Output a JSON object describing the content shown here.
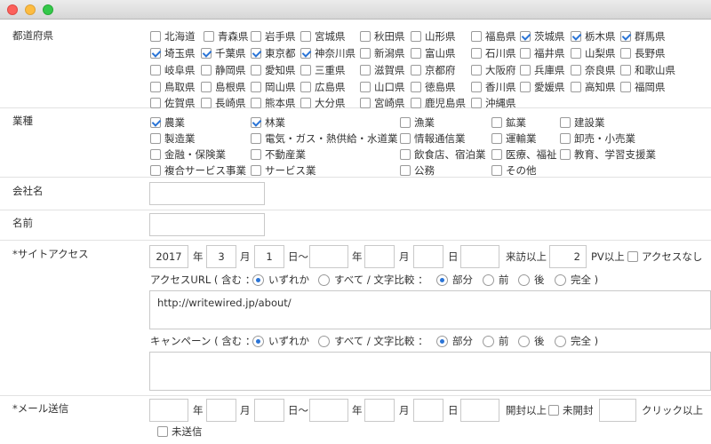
{
  "labels": {
    "prefecture": "都道府県",
    "industry": "業種",
    "company": "会社名",
    "name": "名前",
    "site_access": "*サイトアクセス",
    "mail": "*メール送信"
  },
  "prefectures": [
    {
      "label": "北海道",
      "checked": false
    },
    {
      "label": "青森県",
      "checked": false
    },
    {
      "label": "岩手県",
      "checked": false
    },
    {
      "label": "宮城県",
      "checked": false
    },
    {
      "label": "秋田県",
      "checked": false
    },
    {
      "label": "山形県",
      "checked": false
    },
    {
      "label": "福島県",
      "checked": false
    },
    {
      "label": "茨城県",
      "checked": true
    },
    {
      "label": "栃木県",
      "checked": true
    },
    {
      "label": "群馬県",
      "checked": true
    },
    {
      "label": "埼玉県",
      "checked": true
    },
    {
      "label": "千葉県",
      "checked": true
    },
    {
      "label": "東京都",
      "checked": true
    },
    {
      "label": "神奈川県",
      "checked": true
    },
    {
      "label": "新潟県",
      "checked": false
    },
    {
      "label": "富山県",
      "checked": false
    },
    {
      "label": "石川県",
      "checked": false
    },
    {
      "label": "福井県",
      "checked": false
    },
    {
      "label": "山梨県",
      "checked": false
    },
    {
      "label": "長野県",
      "checked": false
    },
    {
      "label": "岐阜県",
      "checked": false
    },
    {
      "label": "静岡県",
      "checked": false
    },
    {
      "label": "愛知県",
      "checked": false
    },
    {
      "label": "三重県",
      "checked": false
    },
    {
      "label": "滋賀県",
      "checked": false
    },
    {
      "label": "京都府",
      "checked": false
    },
    {
      "label": "大阪府",
      "checked": false
    },
    {
      "label": "兵庫県",
      "checked": false
    },
    {
      "label": "奈良県",
      "checked": false
    },
    {
      "label": "和歌山県",
      "checked": false
    },
    {
      "label": "鳥取県",
      "checked": false
    },
    {
      "label": "島根県",
      "checked": false
    },
    {
      "label": "岡山県",
      "checked": false
    },
    {
      "label": "広島県",
      "checked": false
    },
    {
      "label": "山口県",
      "checked": false
    },
    {
      "label": "徳島県",
      "checked": false
    },
    {
      "label": "香川県",
      "checked": false
    },
    {
      "label": "愛媛県",
      "checked": false
    },
    {
      "label": "高知県",
      "checked": false
    },
    {
      "label": "福岡県",
      "checked": false
    },
    {
      "label": "佐賀県",
      "checked": false
    },
    {
      "label": "長崎県",
      "checked": false
    },
    {
      "label": "熊本県",
      "checked": false
    },
    {
      "label": "大分県",
      "checked": false
    },
    {
      "label": "宮崎県",
      "checked": false
    },
    {
      "label": "鹿児島県",
      "checked": false
    },
    {
      "label": "沖縄県",
      "checked": false
    }
  ],
  "industries": [
    {
      "label": "農業",
      "checked": true
    },
    {
      "label": "林業",
      "checked": true
    },
    {
      "label": "漁業",
      "checked": false
    },
    {
      "label": "鉱業",
      "checked": false
    },
    {
      "label": "建設業",
      "checked": false
    },
    {
      "label": "製造業",
      "checked": false
    },
    {
      "label": "電気・ガス・熱供給・水道業",
      "checked": false
    },
    {
      "label": "情報通信業",
      "checked": false
    },
    {
      "label": "運輸業",
      "checked": false
    },
    {
      "label": "卸売・小売業",
      "checked": false
    },
    {
      "label": "金融・保険業",
      "checked": false
    },
    {
      "label": "不動産業",
      "checked": false
    },
    {
      "label": "飲食店、宿泊業",
      "checked": false
    },
    {
      "label": "医療、福祉",
      "checked": false
    },
    {
      "label": "教育、学習支援業",
      "checked": false
    },
    {
      "label": "複合サービス事業",
      "checked": false
    },
    {
      "label": "サービス業",
      "checked": false
    },
    {
      "label": "公務",
      "checked": false
    },
    {
      "label": "その他",
      "checked": false
    }
  ],
  "access": {
    "year": "2017",
    "month": "3",
    "day": "1",
    "year_unit": "年",
    "month_unit": "月",
    "day_tilde": "日〜",
    "day_unit": "日",
    "visits_label": "来訪以上",
    "pv_value": "2",
    "pv_label": "PV以上",
    "no_access": "アクセスなし",
    "url_prefix": "アクセスURL ( 含む ：",
    "url_value": "http://writewired.jp/about/",
    "campaign_prefix": "キャンペーン ( 含む ：",
    "any": "いずれか",
    "all": "すべて / 文字比較 ：",
    "partial": "部分",
    "front": "前",
    "back": "後",
    "exact": "完全 )"
  },
  "mail": {
    "year_unit": "年",
    "month_unit": "月",
    "day_tilde": "日〜",
    "day_unit": "日",
    "opened_label": "開封以上",
    "unopened": "未開封",
    "click_label": "クリック以上",
    "unsent": "未送信"
  }
}
